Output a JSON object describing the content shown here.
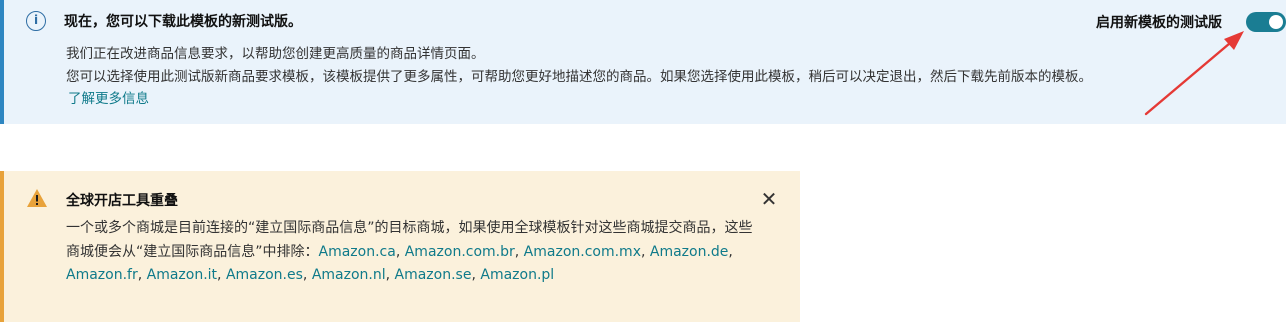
{
  "info_banner": {
    "icon": "info-icon",
    "title": "现在，您可以下载此模板的新测试版。",
    "line1": "我们正在改进商品信息要求，以帮助您创建更高质量的商品详情页面。",
    "line2": "您可以选择使用此测试版新商品要求模板，该模板提供了更多属性，可帮助您更好地描述您的商品。如果您选择使用此模板，稍后可以决定退出，然后下载先前版本的模板。",
    "learn_more": "了解更多信息",
    "toggle_label": "启用新模板的测试版",
    "toggle_on": true,
    "accent_color": "#2e86c1",
    "toggle_color": "#1a7d93"
  },
  "warning_banner": {
    "icon": "warning-triangle-icon",
    "title": "全球开店工具重叠",
    "close_icon": "close-icon",
    "close_glyph": "✕",
    "body_prefix": "一个或多个商城是目前连接的“建立国际商品信息”的目标商城，如果使用全球模板针对这些商城提交商品，这些商城便会从“建立国际商品信息”中排除：",
    "marketplaces": [
      "Amazon.ca",
      "Amazon.com.br",
      "Amazon.com.mx",
      "Amazon.de",
      "Amazon.fr",
      "Amazon.it",
      "Amazon.es",
      "Amazon.nl",
      "Amazon.se",
      "Amazon.pl"
    ],
    "accent_color": "#e8a23a",
    "link_color": "#0f7a8a"
  },
  "annotation": {
    "arrow_color": "#e53935"
  }
}
